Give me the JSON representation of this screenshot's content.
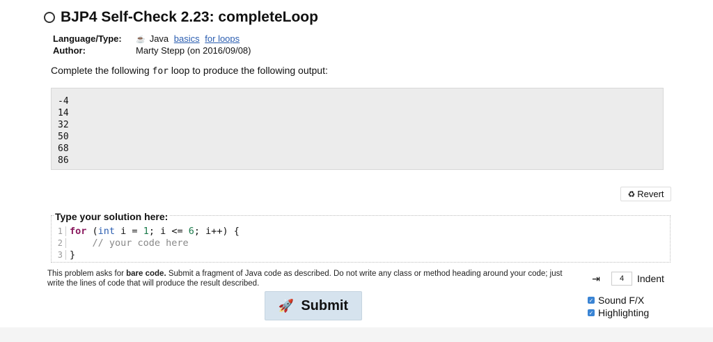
{
  "header": {
    "title": "BJP4 Self-Check 2.23: completeLoop"
  },
  "meta": {
    "language_label": "Language/Type:",
    "language_value": "Java",
    "tag1": "basics",
    "tag2": "for loops",
    "author_label": "Author:",
    "author_value": "Marty Stepp (on 2016/09/08)"
  },
  "prompt": {
    "before": "Complete the following ",
    "code": "for",
    "after": " loop to produce the following output:"
  },
  "output": [
    "-4",
    "14",
    "32",
    "50",
    "68",
    "86"
  ],
  "revert_label": "Revert",
  "solution": {
    "label": "Type your solution here:",
    "line_numbers": [
      "1",
      "2",
      "3"
    ],
    "line1": {
      "kw": "for",
      "p1": " (",
      "type": "int",
      "p2": " i = ",
      "n1": "1",
      "p3": "; i <= ",
      "n2": "6",
      "p4": "; i++) {"
    },
    "line2": "    // your code here",
    "line3": "}"
  },
  "note": {
    "a": "This problem asks for ",
    "b": "bare code.",
    "c": " Submit a fragment of Java code as described. Do not write any class or method heading around your code; just write the lines of code that will produce the result described."
  },
  "submit_label": "Submit",
  "indent": {
    "value": "4",
    "label": "Indent"
  },
  "options": {
    "sound_label": "Sound F/X",
    "highlight_label": "Highlighting"
  }
}
